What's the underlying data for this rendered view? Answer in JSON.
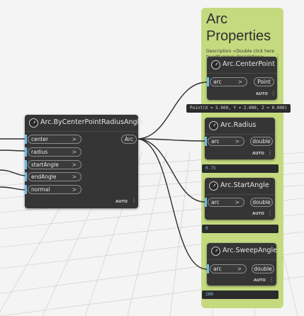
{
  "group": {
    "title": "Arc Properties",
    "description": "Description <Double click here to edit group description>",
    "color": "#c5d97f"
  },
  "main_node": {
    "title": "Arc.ByCenterPointRadiusAngle",
    "inputs": [
      "center",
      "radius",
      "startAngle",
      "endAngle",
      "normal"
    ],
    "output": "Arc",
    "lacing": "AUTO"
  },
  "nodes": {
    "center_point": {
      "title": "Arc.CenterPoint",
      "input": "arc",
      "output": "Point",
      "lacing": "AUTO",
      "preview": "Point(X = 5.000, Y = 2.000, Z = 0.000)"
    },
    "radius": {
      "title": "Arc.Radius",
      "input": "arc",
      "output": "double",
      "lacing": "AUTO",
      "preview": "0.75"
    },
    "start_angle": {
      "title": "Arc.StartAngle",
      "input": "arc",
      "output": "double",
      "lacing": "AUTO",
      "preview": "0"
    },
    "sweep_angle": {
      "title": "Arc.SweepAngle",
      "input": "arc",
      "output": "double",
      "lacing": "AUTO",
      "preview": "180"
    }
  },
  "icons": [
    "arc-node-icon",
    "kebab-menu-icon",
    "chevron-right-icon"
  ],
  "colors": {
    "canvas": "#f4f4f4",
    "node": "#353535",
    "port_accent": "#6dbde6",
    "wire": "#2e2e2e"
  }
}
